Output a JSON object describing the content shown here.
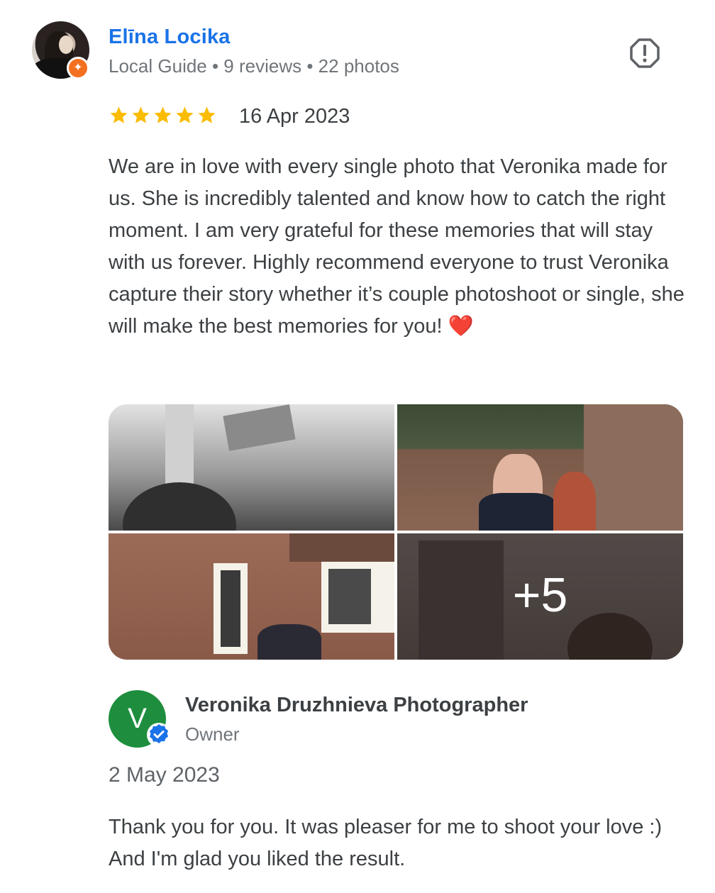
{
  "review": {
    "reviewer_name": "Elīna Locika",
    "reviewer_meta": "Local Guide • 9 reviews • 22 photos",
    "rating": 5,
    "max_rating": 5,
    "date": "16 Apr 2023",
    "text": "We are in love with every single photo that Veronika made for us. She is incredibly talented and know how to catch the right moment. I am very grateful for these memories that will stay with us forever. Highly recommend everyone to trust Veronika capture their story whether it’s couple photoshoot or single, she will make the best memories for you!",
    "text_emoji": "❤️",
    "more_photos_label": "+5"
  },
  "owner_reply": {
    "avatar_letter": "V",
    "name": "Veronika Druzhnieva Photographer",
    "role": "Owner",
    "date": "2 May 2023",
    "text": "Thank you for you. It was pleaser for me to shoot your love :) And I'm glad you liked the result."
  },
  "colors": {
    "link_blue": "#1a73e8",
    "star_yellow": "#fbbc04",
    "guide_orange": "#f37021",
    "owner_green": "#1e8e3e",
    "verified_blue": "#1a73e8"
  },
  "icons": {
    "report": "report-icon",
    "guide_badge": "local-guide-badge-icon",
    "verified": "verified-badge-icon",
    "star": "star-icon"
  }
}
